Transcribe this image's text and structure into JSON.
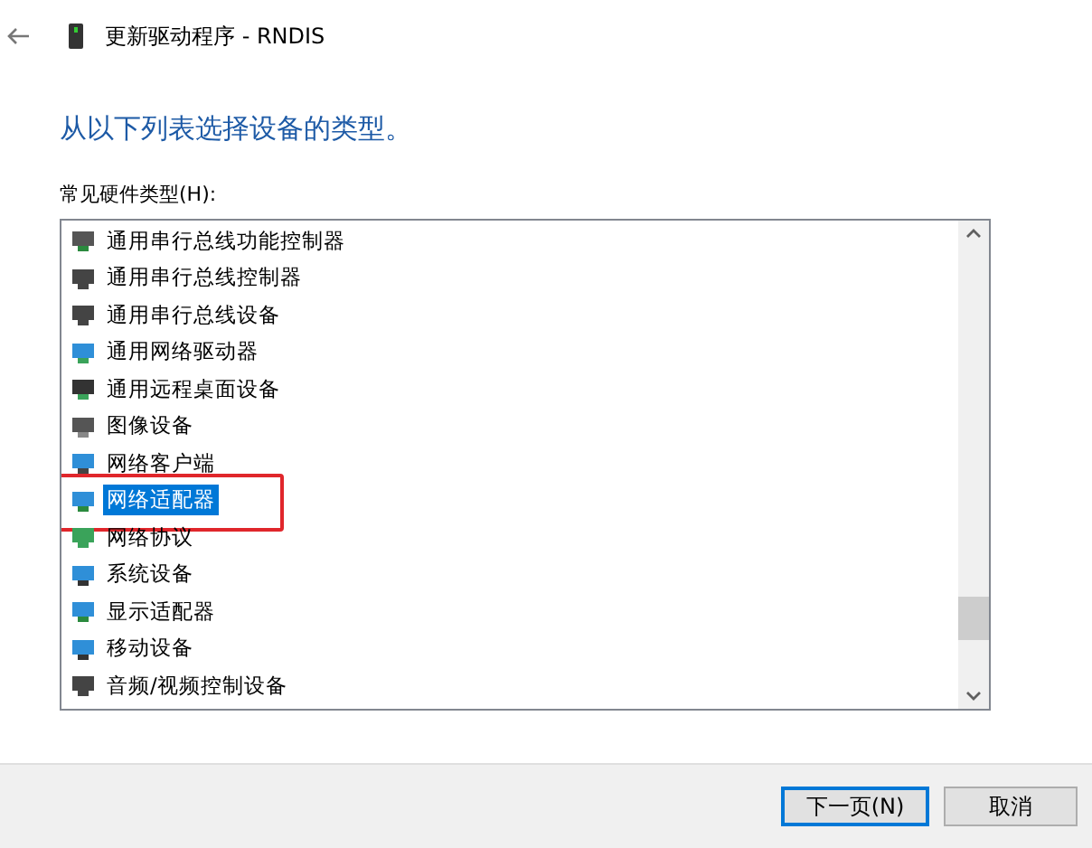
{
  "window": {
    "title": "更新驱动程序 - RNDIS"
  },
  "heading": "从以下列表选择设备的类型。",
  "list_label": "常见硬件类型(H):",
  "list_items": [
    {
      "label": "通用串行总线功能控制器",
      "selected": false,
      "highlighted": false
    },
    {
      "label": "通用串行总线控制器",
      "selected": false,
      "highlighted": false
    },
    {
      "label": "通用串行总线设备",
      "selected": false,
      "highlighted": false
    },
    {
      "label": "通用网络驱动器",
      "selected": false,
      "highlighted": false
    },
    {
      "label": "通用远程桌面设备",
      "selected": false,
      "highlighted": false
    },
    {
      "label": "图像设备",
      "selected": false,
      "highlighted": false
    },
    {
      "label": "网络客户端",
      "selected": false,
      "highlighted": false
    },
    {
      "label": "网络适配器",
      "selected": true,
      "highlighted": true
    },
    {
      "label": "网络协议",
      "selected": false,
      "highlighted": false
    },
    {
      "label": "系统设备",
      "selected": false,
      "highlighted": false
    },
    {
      "label": "显示适配器",
      "selected": false,
      "highlighted": false
    },
    {
      "label": "移动设备",
      "selected": false,
      "highlighted": false
    },
    {
      "label": "音频/视频控制设备",
      "selected": false,
      "highlighted": false
    }
  ],
  "buttons": [
    {
      "label": "下一页(N)",
      "default": true
    },
    {
      "label": "取消",
      "default": false
    }
  ]
}
